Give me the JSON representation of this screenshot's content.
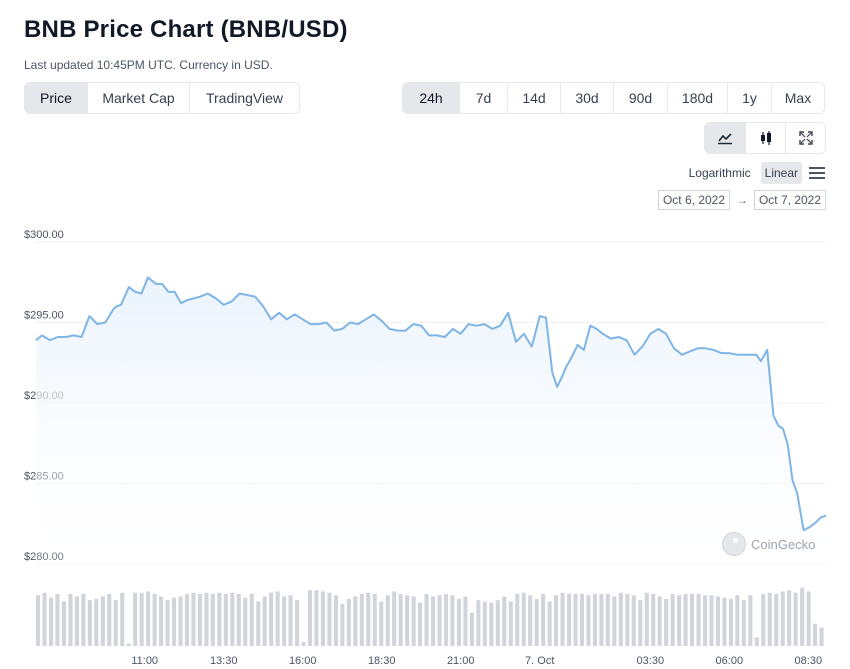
{
  "header": {
    "title": "BNB Price Chart (BNB/USD)",
    "subtitle": "Last updated 10:45PM UTC. Currency in USD."
  },
  "tabs": [
    {
      "label": "Price",
      "active": true
    },
    {
      "label": "Market Cap",
      "active": false
    },
    {
      "label": "TradingView",
      "active": false
    }
  ],
  "ranges": [
    {
      "label": "24h",
      "active": true
    },
    {
      "label": "7d",
      "active": false
    },
    {
      "label": "14d",
      "active": false
    },
    {
      "label": "30d",
      "active": false
    },
    {
      "label": "90d",
      "active": false
    },
    {
      "label": "180d",
      "active": false
    },
    {
      "label": "1y",
      "active": false
    },
    {
      "label": "Max",
      "active": false
    }
  ],
  "views": [
    {
      "icon": "line-chart-icon",
      "active": true
    },
    {
      "icon": "candlestick-icon",
      "active": false
    },
    {
      "icon": "fullscreen-icon",
      "active": false
    }
  ],
  "scale": {
    "logarithmic": "Logarithmic",
    "linear": "Linear",
    "menu_icon": "hamburger-menu-icon"
  },
  "date_range": {
    "from": "Oct 6, 2022",
    "arrow": "→",
    "to": "Oct 7, 2022"
  },
  "watermark": {
    "text": "CoinGecko",
    "icon": "coingecko-logo-icon"
  },
  "colors": {
    "line": "#7fb5e6",
    "fill": "#eaf3fc",
    "volume": "#d1d5db"
  },
  "chart_data": {
    "type": "line",
    "y_ticks": [
      "$300.00",
      "$295.00",
      "$290.00",
      "$285.00",
      "$280.00"
    ],
    "ylim": [
      280,
      300
    ],
    "x_ticks": [
      "11:00",
      "13:30",
      "16:00",
      "18:30",
      "21:00",
      "7. Oct",
      "03:30",
      "06:00",
      "08:30"
    ],
    "x_tick_hours": [
      1.5,
      4.0,
      6.5,
      9.0,
      11.5,
      14.0,
      17.5,
      20.0,
      22.5
    ],
    "x_range_hours": [
      -1.94,
      23.06
    ],
    "series": [
      {
        "x": [
          -1.94,
          -1.75,
          -1.5,
          -1.25,
          -1.0,
          -0.75,
          -0.5,
          -0.25,
          0.0,
          0.25,
          0.5,
          0.6,
          0.75,
          1.0,
          1.2,
          1.4,
          1.6,
          1.85,
          2.05,
          2.25,
          2.45,
          2.65,
          2.85,
          3.05,
          3.25,
          3.5,
          3.75,
          4.0,
          4.25,
          4.5,
          4.75,
          5.0,
          5.25,
          5.5,
          5.75,
          6.0,
          6.25,
          6.5,
          6.75,
          7.0,
          7.25,
          7.5,
          7.75,
          8.0,
          8.25,
          8.5,
          8.75,
          9.0,
          9.25,
          9.5,
          9.75,
          10.0,
          10.25,
          10.5,
          10.75,
          11.0,
          11.25,
          11.5,
          11.75,
          12.0,
          12.25,
          12.5,
          12.75,
          13.0,
          13.25,
          13.5,
          13.75,
          14.0,
          14.2,
          14.4,
          14.55,
          14.7,
          14.85,
          15.0,
          15.2,
          15.4,
          15.6,
          15.8,
          16.0,
          16.25,
          16.5,
          16.75,
          17.0,
          17.25,
          17.5,
          17.75,
          18.0,
          18.25,
          18.5,
          18.75,
          19.0,
          19.25,
          19.5,
          19.75,
          20.0,
          20.25,
          20.5,
          20.7,
          20.85,
          21.0,
          21.2,
          21.4,
          21.55,
          21.7,
          21.85,
          22.0,
          22.15,
          22.35,
          22.55,
          22.75,
          22.9,
          23.06
        ],
        "y": [
          293.9,
          294.2,
          293.9,
          294.1,
          294.1,
          294.2,
          294.1,
          295.4,
          294.9,
          295.0,
          295.8,
          296.0,
          296.1,
          297.2,
          296.9,
          296.8,
          297.8,
          297.4,
          297.4,
          296.9,
          296.9,
          296.2,
          296.4,
          296.5,
          296.6,
          296.8,
          296.5,
          296.1,
          296.3,
          296.8,
          296.7,
          296.6,
          296.0,
          295.2,
          295.6,
          295.2,
          295.5,
          295.2,
          294.9,
          294.9,
          295.0,
          294.5,
          294.6,
          295.0,
          294.9,
          295.2,
          295.5,
          295.1,
          294.6,
          294.5,
          294.5,
          294.9,
          294.8,
          294.2,
          294.2,
          294.1,
          294.6,
          294.3,
          294.9,
          294.8,
          294.9,
          294.6,
          294.8,
          295.6,
          293.8,
          294.3,
          293.5,
          295.4,
          295.3,
          291.9,
          291.0,
          291.6,
          292.3,
          292.8,
          293.6,
          293.3,
          294.8,
          294.6,
          294.3,
          294.0,
          294.1,
          293.9,
          293.0,
          293.5,
          294.3,
          294.6,
          294.3,
          293.4,
          293.0,
          293.2,
          293.4,
          293.4,
          293.3,
          293.1,
          293.1,
          293.0,
          293.0,
          293.0,
          293.0,
          292.6,
          293.3,
          289.2,
          288.6,
          288.4,
          287.4,
          285.2,
          284.4,
          282.1,
          282.3,
          282.6,
          282.9,
          283.0
        ]
      }
    ],
    "volume": [
      0.82,
      0.86,
      0.78,
      0.84,
      0.72,
      0.84,
      0.8,
      0.84,
      0.74,
      0.76,
      0.8,
      0.84,
      0.74,
      0.86,
      0.04,
      0.86,
      0.86,
      0.88,
      0.84,
      0.8,
      0.74,
      0.78,
      0.8,
      0.84,
      0.86,
      0.84,
      0.86,
      0.84,
      0.86,
      0.84,
      0.86,
      0.84,
      0.78,
      0.84,
      0.72,
      0.8,
      0.86,
      0.88,
      0.8,
      0.82,
      0.74,
      0.06,
      0.9,
      0.9,
      0.88,
      0.86,
      0.82,
      0.68,
      0.76,
      0.8,
      0.84,
      0.86,
      0.84,
      0.72,
      0.82,
      0.88,
      0.84,
      0.82,
      0.8,
      0.7,
      0.84,
      0.8,
      0.82,
      0.84,
      0.82,
      0.76,
      0.8,
      0.54,
      0.74,
      0.72,
      0.7,
      0.74,
      0.8,
      0.72,
      0.84,
      0.86,
      0.82,
      0.76,
      0.84,
      0.72,
      0.82,
      0.86,
      0.84,
      0.84,
      0.84,
      0.82,
      0.84,
      0.84,
      0.84,
      0.8,
      0.86,
      0.84,
      0.82,
      0.74,
      0.86,
      0.84,
      0.8,
      0.76,
      0.84,
      0.82,
      0.84,
      0.84,
      0.84,
      0.82,
      0.82,
      0.8,
      0.78,
      0.76,
      0.82,
      0.74,
      0.82,
      0.14,
      0.84,
      0.86,
      0.84,
      0.88,
      0.9,
      0.86,
      0.94,
      0.88,
      0.36,
      0.3
    ]
  }
}
